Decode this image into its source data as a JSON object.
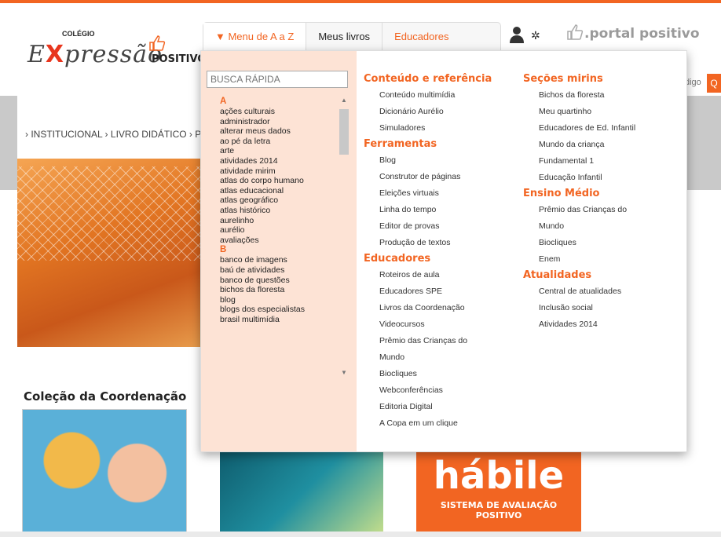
{
  "logo": {
    "colegio": "COLÉGIO",
    "brand_pre": "E",
    "brand_x": "X",
    "brand_post": "pressão",
    "positivo": "POSITIVO"
  },
  "menubar": {
    "items": [
      "▼ Menu de A a Z",
      "Meus livros",
      "Educadores"
    ]
  },
  "portal": "portal positivo",
  "search": {
    "partial": "digo",
    "button": "Q"
  },
  "hero": {
    "breadcrumb": "› INSTITUCIONAL   › LIVRO DIDÁTICO   › P"
  },
  "colecao": "Coleção da Coordenação",
  "habile": {
    "title": "hábile",
    "subtitle": "SISTEMA DE AVALIAÇÃO POSITIVO"
  },
  "dropdown": {
    "busca_placeholder": "BUSCA RÁPIDA",
    "az": [
      {
        "letter": "A",
        "items": [
          "ações culturais",
          "administrador",
          "alterar meus dados",
          "ao pé da letra",
          "arte",
          "atividades 2014",
          "atividade mirim",
          "atlas do corpo humano",
          "atlas educacional",
          "atlas geográfico",
          "atlas histórico",
          "aurelinho",
          "aurélio",
          "avaliações"
        ]
      },
      {
        "letter": "B",
        "items": [
          "banco de imagens",
          "baú de atividades",
          "banco de questões",
          "bichos da floresta",
          "blog",
          "blogs dos especialistas",
          "brasil multimídia"
        ]
      }
    ],
    "col1": [
      {
        "heading": "Conteúdo e referência",
        "items": [
          "Conteúdo multimídia",
          "Dicionário Aurélio",
          "Simuladores"
        ]
      },
      {
        "heading": "Ferramentas",
        "items": [
          "Blog",
          "Construtor de páginas",
          "Eleições virtuais",
          "Linha do tempo",
          "Editor de provas",
          "Produção de textos"
        ]
      },
      {
        "heading": "Educadores",
        "items": [
          "Roteiros de aula",
          "Educadores SPE",
          "Livros da Coordenação",
          "Videocursos",
          "Prêmio das Crianças do",
          "Mundo",
          "Biocliques",
          "Webconferências",
          "Editoria Digital",
          "A Copa em um clique"
        ]
      }
    ],
    "col2": [
      {
        "heading": "Seções mirins",
        "items": [
          "Bichos da floresta",
          "Meu quartinho",
          "Educadores de Ed. Infantil",
          "Mundo da criança",
          "Fundamental 1",
          "Educação Infantil"
        ]
      },
      {
        "heading": "Ensino Médio",
        "items": [
          "Prêmio das Crianças do",
          "Mundo",
          "Biocliques",
          "Enem"
        ]
      },
      {
        "heading": "Atualidades",
        "items": [
          "Central de atualidades",
          "Inclusão social",
          "Atividades 2014"
        ]
      }
    ]
  },
  "colors": {
    "accent": "#f26522",
    "panel": "#fde3d5"
  }
}
